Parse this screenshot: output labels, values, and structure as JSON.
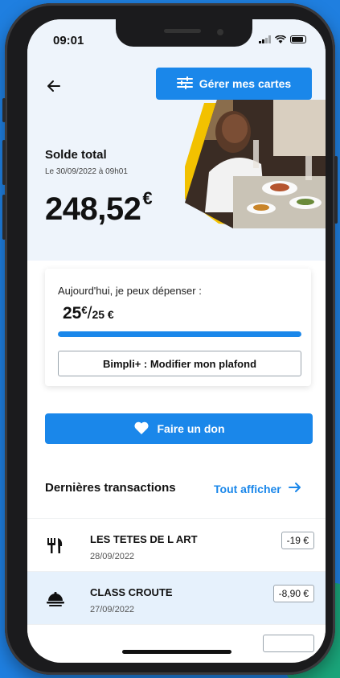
{
  "status": {
    "time": "09:01"
  },
  "header": {
    "manage_cards_label": "Gérer mes cartes"
  },
  "balance": {
    "title": "Solde total",
    "date": "Le 30/09/2022 à 09h01",
    "amount": "248,52",
    "currency": "€"
  },
  "daily": {
    "label": "Aujourd'hui, je peux dépenser :",
    "available": "25",
    "available_currency": "€",
    "separator": "/",
    "limit": "25 €",
    "progress_fraction": 1.0,
    "modify_button_label": "Bimpli+ : Modifier mon plafond"
  },
  "donate": {
    "label": "Faire un don"
  },
  "transactions": {
    "title": "Dernières transactions",
    "show_all_label": "Tout afficher",
    "items": [
      {
        "name": "LES TETES DE L ART",
        "date": "28/09/2022",
        "amount": "-19 €",
        "icon": "restaurant-icon"
      },
      {
        "name": "CLASS CROUTE",
        "date": "27/09/2022",
        "amount": "-8,90 €",
        "icon": "food-tray-icon"
      }
    ]
  },
  "colors": {
    "accent": "#1a87ea",
    "background": "#1f7fe0",
    "highlight_row": "#e6f1fc"
  }
}
